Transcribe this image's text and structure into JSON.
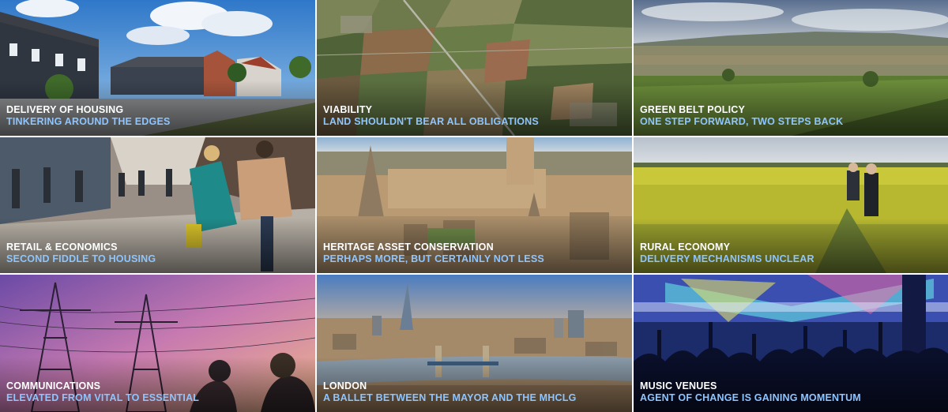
{
  "tiles": [
    {
      "title": "DELIVERY OF HOUSING",
      "subtitle": "TINKERING AROUND THE EDGES",
      "image": "housing-photo"
    },
    {
      "title": "VIABILITY",
      "subtitle": "LAND SHOULDN'T BEAR ALL OBLIGATIONS",
      "image": "aerial-farmland-photo"
    },
    {
      "title": "GREEN BELT POLICY",
      "subtitle": "ONE STEP FORWARD, TWO STEPS BACK",
      "image": "countryside-valley-photo"
    },
    {
      "title": "RETAIL & ECONOMICS",
      "subtitle": "SECOND FIDDLE TO HOUSING",
      "image": "shopping-street-photo"
    },
    {
      "title": "HERITAGE ASSET CONSERVATION",
      "subtitle": "PERHAPS MORE, BUT CERTAINLY NOT LESS",
      "image": "historic-city-aerial-photo"
    },
    {
      "title": "RURAL ECONOMY",
      "subtitle": "DELIVERY MECHANISMS UNCLEAR",
      "image": "rapeseed-field-photo"
    },
    {
      "title": "COMMUNICATIONS",
      "subtitle": "ELEVATED FROM VITAL TO ESSENTIAL",
      "image": "pylons-sunset-photo"
    },
    {
      "title": "LONDON",
      "subtitle": "A BALLET BETWEEN THE MAYOR AND THE MHCLG",
      "image": "london-skyline-photo"
    },
    {
      "title": "MUSIC VENUES",
      "subtitle": "AGENT OF CHANGE IS GAINING MOMENTUM",
      "image": "concert-crowd-photo"
    }
  ],
  "colors": {
    "title": "#ffffff",
    "subtitle": "#8ec5ff"
  }
}
